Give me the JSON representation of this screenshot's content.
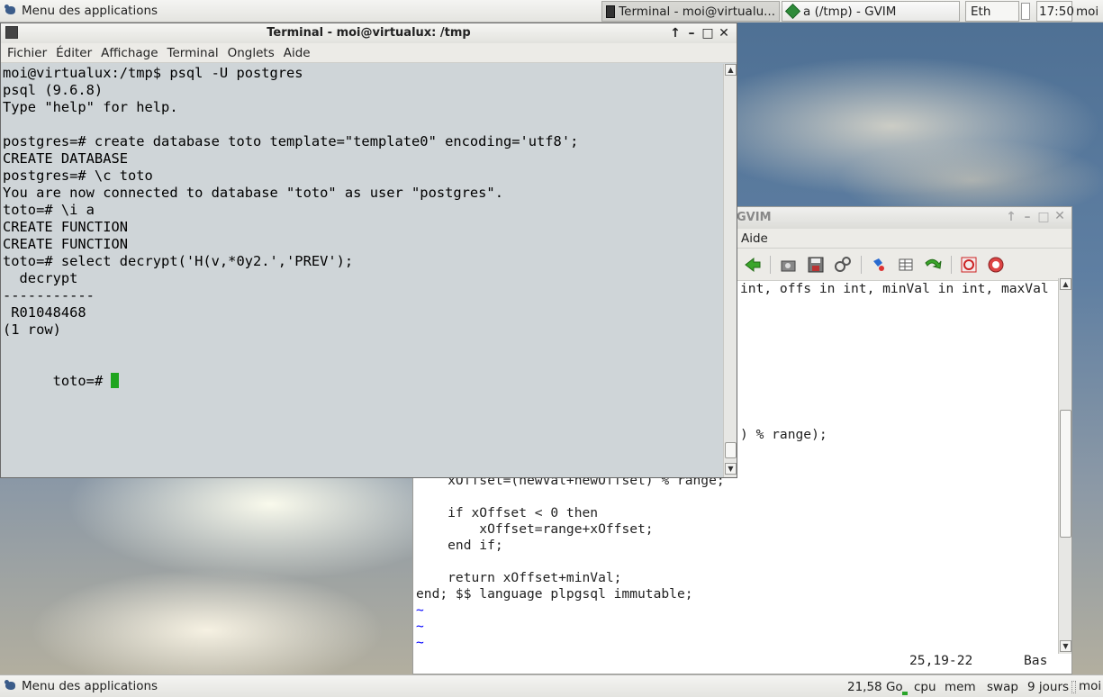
{
  "top_panel": {
    "apps_menu_label": "Menu des applications",
    "tasks": [
      {
        "label": "Terminal - moi@virtualu...",
        "icon": "terminal-icon",
        "active": true
      },
      {
        "label": "a (/tmp) - GVIM",
        "icon": "vim-icon",
        "active": false
      }
    ],
    "network_label": "Eth",
    "clock": "17:50",
    "user": "moi"
  },
  "bottom_panel": {
    "apps_menu_label": "Menu des applications",
    "disk_free": "21,58 Go",
    "cpu_label": "cpu",
    "mem_label": "mem",
    "swap_label": "swap",
    "uptime": "9 jours"
  },
  "terminal": {
    "title": "Terminal - moi@virtualux: /tmp",
    "menu": [
      "Fichier",
      "Éditer",
      "Affichage",
      "Terminal",
      "Onglets",
      "Aide"
    ],
    "lines": [
      "moi@virtualux:/tmp$ psql -U postgres",
      "psql (9.6.8)",
      "Type \"help\" for help.",
      "",
      "postgres=# create database toto template=\"template0\" encoding='utf8';",
      "CREATE DATABASE",
      "postgres=# \\c toto",
      "You are now connected to database \"toto\" as user \"postgres\".",
      "toto=# \\i a",
      "CREATE FUNCTION",
      "CREATE FUNCTION",
      "toto=# select decrypt('H(v,*0y2.','PREV');",
      "  decrypt",
      "-----------",
      " R01048468",
      "(1 row)",
      ""
    ],
    "prompt": "toto=# "
  },
  "gvim": {
    "title_visible": "GVIM",
    "menu_visible": "Aide",
    "lines": [
      {
        "row": 0,
        "text": "int, offs in int, minVal in int, maxVal"
      },
      {
        "row": 9,
        "text": ") % range);"
      },
      {
        "row": 12,
        "text": "    xOffset=(newVal+newOffset) % range;"
      },
      {
        "row": 14,
        "text": "    if xOffset < 0 then"
      },
      {
        "row": 15,
        "text": "        xOffset=range+xOffset;"
      },
      {
        "row": 16,
        "text": "    end if;"
      },
      {
        "row": 18,
        "text": "    return xOffset+minVal;"
      },
      {
        "row": 19,
        "text": "end; $$ language plpgsql immutable;"
      }
    ],
    "tildes": [
      "~",
      "~",
      "~"
    ],
    "ruler_position": "25,19-22",
    "ruler_scroll": "Bas",
    "toolbar_icons": [
      "back-arrow-icon",
      "load-session-icon",
      "save-session-icon",
      "run-script-icon",
      "make-icon",
      "ctags-icon",
      "jump-tag-icon",
      "help-icon",
      "find-help-icon"
    ]
  }
}
